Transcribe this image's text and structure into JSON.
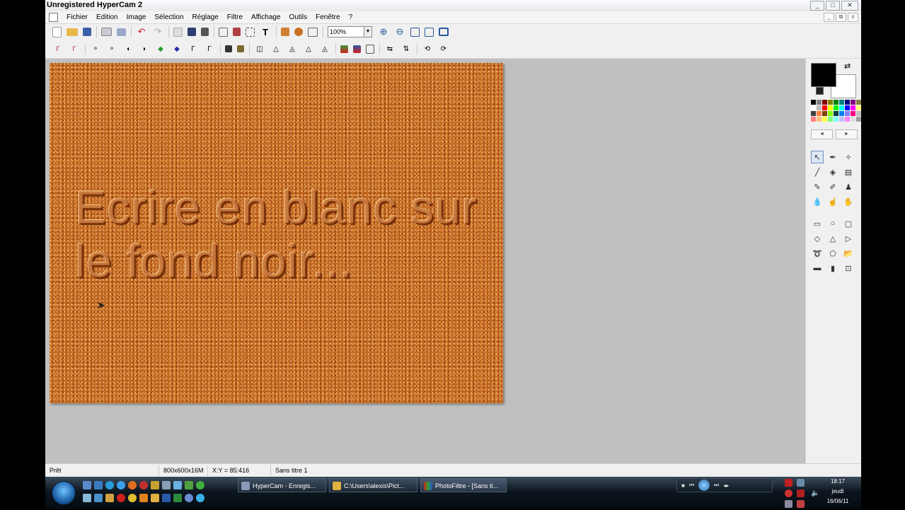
{
  "window": {
    "title": "Unregistered HyperCam 2"
  },
  "window_buttons": {
    "minimize": "_",
    "maximize": "□",
    "close": "✕"
  },
  "mdi_buttons": {
    "minimize": "_",
    "restore": "⧉",
    "close": "x"
  },
  "menu": [
    "Fichier",
    "Edition",
    "Image",
    "Sélection",
    "Réglage",
    "Filtre",
    "Affichage",
    "Outils",
    "Fenêtre",
    "?"
  ],
  "toolbar": {
    "zoom_value": "100%"
  },
  "canvas": {
    "text_lines": [
      "Ecrire en blanc sur",
      "le fond noir..."
    ]
  },
  "palette": {
    "prev": "◄",
    "next": "►"
  },
  "colors": {
    "foreground": "#000000",
    "background": "#ffffff",
    "canvas_base": "#c66a1f",
    "palette": [
      "#000000",
      "#808080",
      "#800000",
      "#808000",
      "#008000",
      "#008080",
      "#000080",
      "#800080",
      "#808040",
      "#ffffff",
      "#c0c0c0",
      "#ff0000",
      "#ffff00",
      "#00ff00",
      "#00ffff",
      "#0000ff",
      "#ff00ff",
      "#ffff80",
      "#404040",
      "#ff8040",
      "#804000",
      "#80ff00",
      "#004040",
      "#0080ff",
      "#8080ff",
      "#ff0080",
      "#c0c0c0",
      "#ff8080",
      "#ffc080",
      "#ffff40",
      "#80ff80",
      "#80ffff",
      "#c0c0ff",
      "#ff80ff",
      "#e0e0e0",
      "#a0a0a0"
    ]
  },
  "status": {
    "state": "Prêt",
    "image_size": "800x600x16M",
    "coords": "X:Y = 85:416",
    "document": "Sans titre 1"
  },
  "taskbar": {
    "tasks": [
      "HyperCam - Enregis...",
      "C:\\Users\\alexis\\Pict...",
      "PhotoFiltre - [Sans ti..."
    ],
    "time": "18:17",
    "day": "jeudi",
    "date": "16/06/11"
  }
}
